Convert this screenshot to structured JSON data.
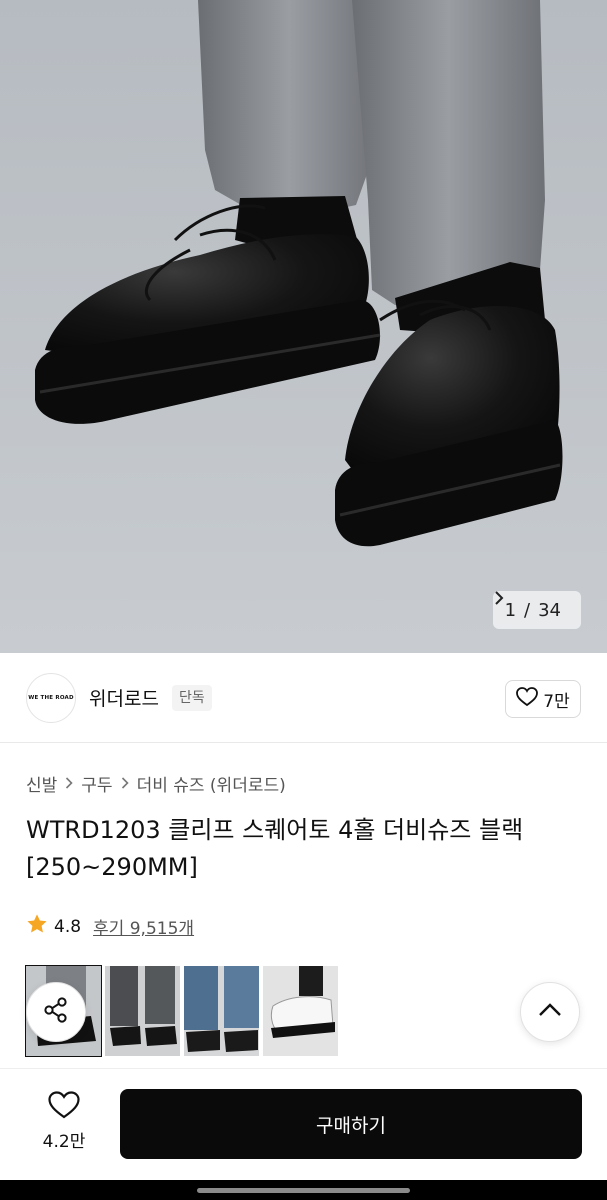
{
  "gallery": {
    "counter_current": "1",
    "counter_separator": "/",
    "counter_total": "34",
    "next_icon": "chevron-right"
  },
  "brand": {
    "logo_text": "WE THE ROAD",
    "name": "위더로드",
    "badge": "단독",
    "like_count": "7만"
  },
  "breadcrumb": {
    "items": [
      "신발",
      "구두",
      "더비 슈즈 (위더로드)"
    ]
  },
  "product": {
    "title": "WTRD1203 클리프 스퀘어토 4홀 더비슈즈 블랙 [250~290MM]",
    "rating": "4.8",
    "reviews": "후기 9,515개"
  },
  "thumbnails": {
    "count": 4,
    "active_index": 0
  },
  "actions": {
    "share_icon": "share-icon",
    "scroll_top_icon": "chevron-up-icon"
  },
  "bottom_bar": {
    "wish_count": "4.2만",
    "buy_label": "구매하기"
  },
  "colors": {
    "accent_black": "#0a0a0a",
    "star": "#f5a623"
  }
}
